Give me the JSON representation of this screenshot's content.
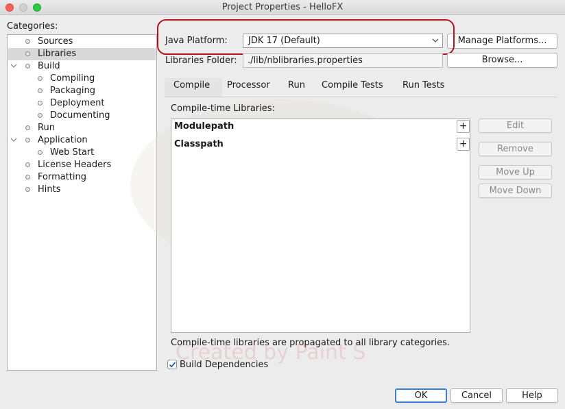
{
  "window": {
    "title": "Project Properties - HelloFX"
  },
  "categories": {
    "label": "Categories:",
    "items": [
      {
        "label": "Sources"
      },
      {
        "label": "Libraries"
      },
      {
        "label": "Build"
      },
      {
        "label": "Compiling"
      },
      {
        "label": "Packaging"
      },
      {
        "label": "Deployment"
      },
      {
        "label": "Documenting"
      },
      {
        "label": "Run"
      },
      {
        "label": "Application"
      },
      {
        "label": "Web Start"
      },
      {
        "label": "License Headers"
      },
      {
        "label": "Formatting"
      },
      {
        "label": "Hints"
      }
    ],
    "selected": "Libraries"
  },
  "platform": {
    "label": "Java Platform:",
    "value": "JDK 17 (Default)",
    "manage_button": "Manage Platforms..."
  },
  "libraries_folder": {
    "label": "Libraries Folder:",
    "value": "./lib/nblibraries.properties",
    "browse_button": "Browse..."
  },
  "tabs": [
    {
      "label": "Compile"
    },
    {
      "label": "Processor"
    },
    {
      "label": "Run"
    },
    {
      "label": "Compile Tests"
    },
    {
      "label": "Run Tests"
    }
  ],
  "active_tab": "Compile",
  "compile": {
    "label": "Compile-time Libraries:",
    "sections": [
      {
        "label": "Modulepath"
      },
      {
        "label": "Classpath"
      }
    ],
    "buttons": {
      "edit": "Edit",
      "remove": "Remove",
      "move_up": "Move Up",
      "move_down": "Move Down"
    },
    "note": "Compile-time libraries are propagated to all library categories.",
    "build_dependencies": {
      "label": "Build Dependencies",
      "checked": true
    }
  },
  "watermark": "Created by Paint S",
  "footer": {
    "ok": "OK",
    "cancel": "Cancel",
    "help": "Help"
  },
  "colors": {
    "highlight": "#b5141f",
    "default_button": "#3a7fd6"
  }
}
